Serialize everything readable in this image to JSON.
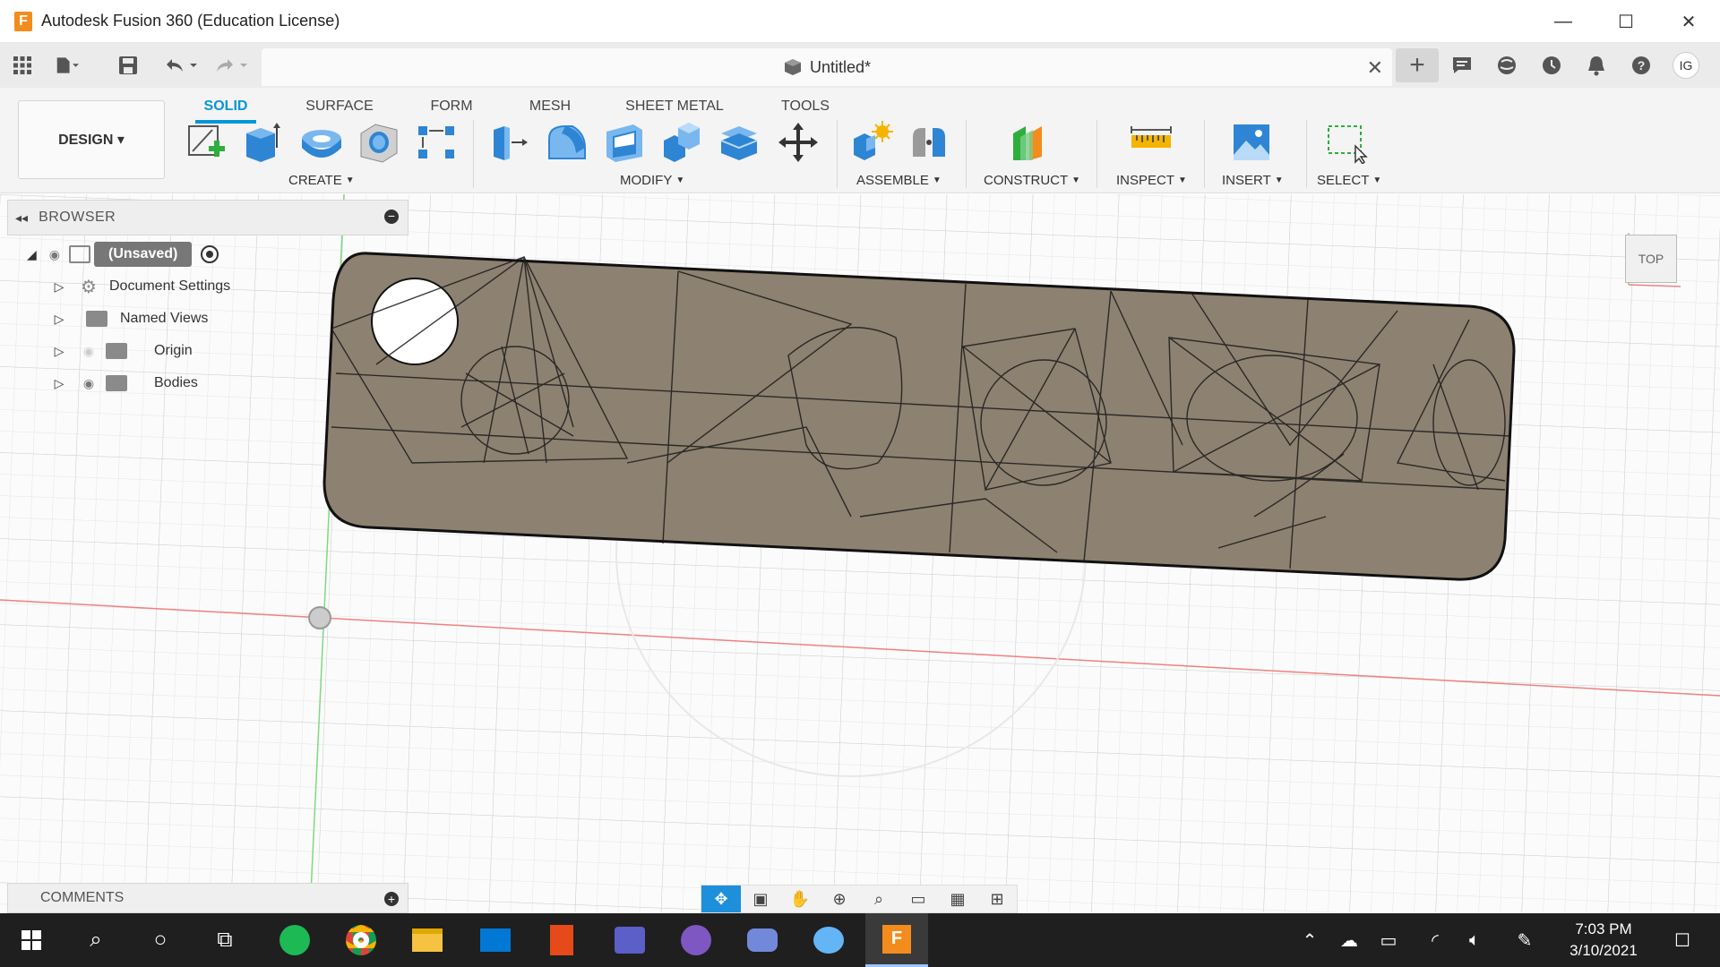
{
  "window": {
    "title": "Autodesk Fusion 360 (Education License)",
    "logo_letter": "F",
    "minimize": "—",
    "maximize": "☐",
    "close": "✕"
  },
  "document": {
    "title": "Untitled*",
    "close": "✕"
  },
  "user": {
    "initials": "IG"
  },
  "workspace": {
    "label": "DESIGN ▾"
  },
  "tabs": [
    {
      "label": "SOLID",
      "active": true
    },
    {
      "label": "SURFACE",
      "active": false
    },
    {
      "label": "FORM",
      "active": false
    },
    {
      "label": "MESH",
      "active": false
    },
    {
      "label": "SHEET METAL",
      "active": false
    },
    {
      "label": "TOOLS",
      "active": false
    }
  ],
  "groups": {
    "create": "CREATE",
    "modify": "MODIFY",
    "assemble": "ASSEMBLE",
    "construct": "CONSTRUCT",
    "inspect": "INSPECT",
    "insert": "INSERT",
    "select": "SELECT"
  },
  "browser": {
    "title": "BROWSER",
    "root": "(Unsaved)",
    "items": [
      {
        "label": "Document Settings"
      },
      {
        "label": "Named Views"
      },
      {
        "label": "Origin"
      },
      {
        "label": "Bodies"
      }
    ]
  },
  "comments": {
    "title": "COMMENTS"
  },
  "viewcube": {
    "face": "TOP"
  },
  "clock": {
    "time": "7:03 PM",
    "date": "3/10/2021"
  },
  "colors": {
    "accent": "#0696d7",
    "mesh_fill": "#8d8171",
    "taskbar": "#1f1f1f"
  }
}
